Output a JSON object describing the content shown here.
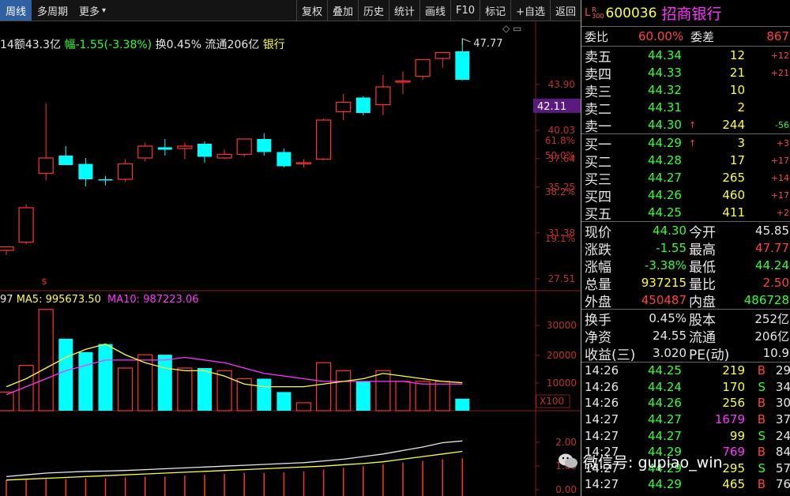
{
  "toolbar": {
    "left": [
      "周线",
      "多周期",
      "更多"
    ],
    "right": [
      "复权",
      "叠加",
      "历史",
      "统计",
      "画线",
      "F10",
      "标记",
      "+自选",
      "返回"
    ]
  },
  "info": {
    "prefix": "14",
    "amount": "额43.3亿",
    "change": "幅-1.55(-3.38%)",
    "turnover": "换0.45%",
    "float_cap": "流通206亿",
    "industry": "银行"
  },
  "price_axis": [
    "43.90",
    "40.03",
    "37.64",
    "35.25",
    "31.38",
    "27.51"
  ],
  "pct_axis": [
    "61.8%",
    "50.0%",
    "38.2%",
    "19.1%"
  ],
  "current_price_tag": "42.11",
  "high_label": "47.77",
  "vol_axis": [
    "30000",
    "20000",
    "10000"
  ],
  "vol_unit": "X100",
  "macd_axis": [
    "2.00",
    "1.00",
    "0.00"
  ],
  "vol_legend": {
    "prefix": "97",
    "ma5": "MA5: 995673.50",
    "ma10": "MA10: 987223.06"
  },
  "colors": {
    "up": "#ff3232",
    "down": "#00ffff",
    "ma5": "#ffff33",
    "ma10": "#ff33ff",
    "tag": "#5b1a80"
  },
  "chart_data": {
    "type": "candlestick",
    "candles": [
      {
        "o": 29.9,
        "h": 30.2,
        "l": 29.5,
        "c": 30.2
      },
      {
        "o": 30.6,
        "h": 33.8,
        "l": 30.4,
        "c": 33.5
      },
      {
        "o": 36.4,
        "h": 42.3,
        "l": 35.8,
        "c": 37.7
      },
      {
        "o": 37.9,
        "h": 38.7,
        "l": 37.1,
        "c": 37.1
      },
      {
        "o": 37.2,
        "h": 37.7,
        "l": 35.3,
        "c": 35.9
      },
      {
        "o": 35.9,
        "h": 36.2,
        "l": 35.4,
        "c": 35.8
      },
      {
        "o": 35.9,
        "h": 37.6,
        "l": 35.7,
        "c": 37.2
      },
      {
        "o": 37.7,
        "h": 39.0,
        "l": 37.4,
        "c": 38.7
      },
      {
        "o": 38.6,
        "h": 39.3,
        "l": 37.9,
        "c": 38.4
      },
      {
        "o": 38.5,
        "h": 39.0,
        "l": 37.6,
        "c": 38.7
      },
      {
        "o": 38.9,
        "h": 39.1,
        "l": 37.3,
        "c": 37.8
      },
      {
        "o": 37.7,
        "h": 38.4,
        "l": 37.6,
        "c": 38.0
      },
      {
        "o": 38.0,
        "h": 39.3,
        "l": 37.8,
        "c": 39.3
      },
      {
        "o": 39.3,
        "h": 39.8,
        "l": 37.9,
        "c": 38.2
      },
      {
        "o": 38.2,
        "h": 38.5,
        "l": 36.9,
        "c": 37.0
      },
      {
        "o": 37.3,
        "h": 37.6,
        "l": 36.9,
        "c": 37.3
      },
      {
        "o": 37.6,
        "h": 41.0,
        "l": 37.5,
        "c": 40.9
      },
      {
        "o": 41.6,
        "h": 43.1,
        "l": 40.9,
        "c": 42.4
      },
      {
        "o": 42.8,
        "h": 42.9,
        "l": 41.3,
        "c": 41.5
      },
      {
        "o": 42.2,
        "h": 44.7,
        "l": 41.3,
        "c": 43.7
      },
      {
        "o": 44.1,
        "h": 45.0,
        "l": 43.1,
        "c": 44.2
      },
      {
        "o": 44.6,
        "h": 46.0,
        "l": 44.3,
        "c": 46.0
      },
      {
        "o": 46.1,
        "h": 46.6,
        "l": 45.3,
        "c": 46.6
      },
      {
        "o": 46.7,
        "h": 47.77,
        "l": 44.24,
        "c": 44.3
      }
    ],
    "volumes": [
      0.7,
      1.7,
      3.8,
      2.7,
      2.2,
      2.5,
      1.6,
      2.1,
      2.1,
      1.6,
      1.6,
      1.5,
      1.2,
      1.2,
      0.7,
      0.3,
      1.8,
      1.5,
      1.1,
      1.5,
      1.1,
      1.1,
      1.1,
      0.45
    ],
    "ma5": [
      0.9,
      1.2,
      1.6,
      2.0,
      2.3,
      2.5,
      2.1,
      1.8,
      1.6,
      1.5,
      1.5,
      1.3,
      1.0,
      0.9,
      0.9,
      0.9,
      1.0,
      1.1,
      1.2,
      1.4,
      1.3,
      1.2,
      1.1,
      1.05
    ],
    "ma10": [
      0.6,
      0.9,
      1.2,
      1.5,
      1.7,
      1.9,
      1.9,
      1.9,
      1.9,
      2.0,
      1.9,
      1.8,
      1.6,
      1.4,
      1.3,
      1.2,
      1.1,
      1.1,
      1.1,
      1.1,
      1.1,
      1.0,
      1.0,
      1.0
    ],
    "dif": [
      0.3,
      0.4,
      0.5,
      0.55,
      0.6,
      0.62,
      0.65,
      0.7,
      0.75,
      0.8,
      0.85,
      0.9,
      0.95,
      1.0,
      1.05,
      1.1,
      1.2,
      1.3,
      1.45,
      1.6,
      1.8,
      2.0,
      2.25,
      2.35
    ],
    "dea": [
      0.1,
      0.15,
      0.2,
      0.25,
      0.3,
      0.35,
      0.4,
      0.45,
      0.5,
      0.55,
      0.6,
      0.65,
      0.7,
      0.75,
      0.8,
      0.85,
      0.9,
      0.98,
      1.05,
      1.15,
      1.3,
      1.45,
      1.6,
      1.75
    ],
    "macd": [
      0.1,
      0.1,
      0.15,
      0.15,
      0.2,
      0.2,
      0.25,
      0.3,
      0.3,
      0.35,
      0.4,
      0.45,
      0.5,
      0.5,
      0.55,
      0.6,
      0.7,
      0.8,
      0.9,
      1.0,
      1.1,
      1.2,
      1.3,
      1.35
    ],
    "price_range": [
      26.5,
      48.9
    ],
    "vol_range": [
      0,
      4.0
    ]
  },
  "quote": {
    "code": "600036",
    "name": "招商银行",
    "marker": "L",
    "weibi_label": "委比",
    "weibi": "60.00%",
    "weicha_label": "委差",
    "weicha": "867",
    "asks": [
      {
        "label": "卖五",
        "price": "44.34",
        "vol": "12",
        "chg": "+12"
      },
      {
        "label": "卖四",
        "price": "44.33",
        "vol": "21",
        "chg": "+21"
      },
      {
        "label": "卖三",
        "price": "44.32",
        "vol": "10",
        "chg": ""
      },
      {
        "label": "卖二",
        "price": "44.31",
        "vol": "2",
        "chg": ""
      },
      {
        "label": "卖一",
        "price": "44.30",
        "vol": "244",
        "chg": "-56"
      }
    ],
    "bids": [
      {
        "label": "买一",
        "price": "44.29",
        "vol": "3",
        "chg": "+3"
      },
      {
        "label": "买二",
        "price": "44.28",
        "vol": "17",
        "chg": "+17"
      },
      {
        "label": "买三",
        "price": "44.27",
        "vol": "265",
        "chg": "+14"
      },
      {
        "label": "买四",
        "price": "44.26",
        "vol": "460",
        "chg": "+17"
      },
      {
        "label": "买五",
        "price": "44.25",
        "vol": "411",
        "chg": "+2"
      }
    ],
    "stats": [
      {
        "l1": "现价",
        "v1": "44.30",
        "l2": "今开",
        "v2": "45.85"
      },
      {
        "l1": "涨跌",
        "v1": "-1.55",
        "l2": "最高",
        "v2": "47.77"
      },
      {
        "l1": "涨幅",
        "v1": "-3.38%",
        "l2": "最低",
        "v2": "44.24"
      },
      {
        "l1": "总量",
        "v1": "937215",
        "l2": "量比",
        "v2": "2.50"
      },
      {
        "l1": "外盘",
        "v1": "450487",
        "l2": "内盘",
        "v2": "486728"
      }
    ],
    "fund": [
      {
        "l1": "换手",
        "v1": "0.45%",
        "l2": "股本",
        "v2": "252亿"
      },
      {
        "l1": "净资",
        "v1": "24.55",
        "l2": "流通",
        "v2": "206亿"
      },
      {
        "l1": "收益(三)",
        "v1": "3.020",
        "l2": "PE(动)",
        "v2": "10.9"
      }
    ],
    "ticks": [
      {
        "t": "14:26",
        "p": "44.25",
        "v": "219",
        "s": "B",
        "n": "29"
      },
      {
        "t": "14:26",
        "p": "44.24",
        "v": "170",
        "s": "S",
        "n": "34"
      },
      {
        "t": "14:26",
        "p": "44.26",
        "v": "256",
        "s": "B",
        "n": "30"
      },
      {
        "t": "14:27",
        "p": "44.27",
        "v": "1679",
        "s": "B",
        "n": "37"
      },
      {
        "t": "14:27",
        "p": "44.27",
        "v": "99",
        "s": "S",
        "n": "24"
      },
      {
        "t": "14:27",
        "p": "44.29",
        "v": "769",
        "s": "B",
        "n": "84"
      },
      {
        "t": "14:27",
        "p": "44.29",
        "v": "295",
        "s": "S",
        "n": "57"
      },
      {
        "t": "14:27",
        "p": "44.29",
        "v": "465",
        "s": "B",
        "n": "76"
      }
    ]
  },
  "watermark": {
    "text": "微信号: gupiao_win"
  }
}
